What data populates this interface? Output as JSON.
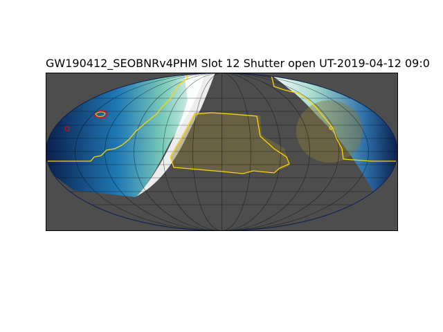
{
  "figure": {
    "title": "GW190412_SEOBNRv4PHM Slot 12 Shutter open UT-2019-04-12 09:0",
    "projection": "mollweide",
    "grid": true
  },
  "colors": {
    "background_mask": "#4d4d4d",
    "sky_dark": "#0b1f4d",
    "sky_mid": "#1f78b4",
    "sky_light": "#7fcdbb",
    "sky_bright": "#ffffff",
    "footprint_outline": "#ffd700",
    "moon_shade": "#8a7a3a",
    "gw_contour": "#ff0000",
    "grid_line": "#000000"
  }
}
